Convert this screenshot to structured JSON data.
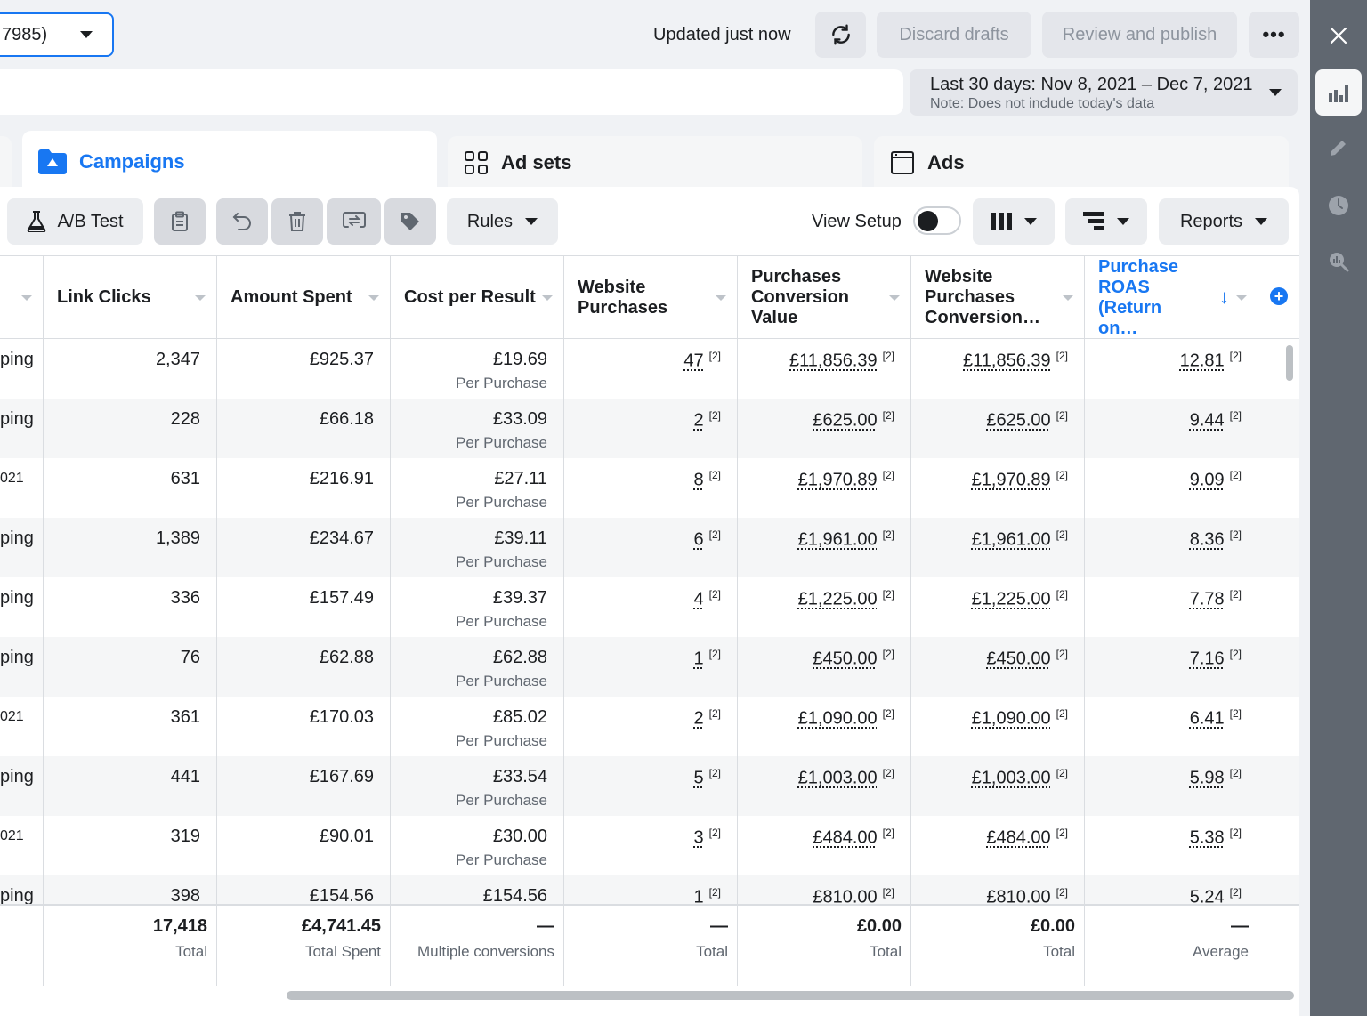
{
  "topbar": {
    "account_value": "7985)",
    "updated_text": "Updated just now",
    "discard_label": "Discard drafts",
    "publish_label": "Review and publish",
    "more_label": "•••"
  },
  "date": {
    "range": "Last 30 days: Nov 8, 2021 – Dec 7, 2021",
    "note": "Note: Does not include today's data"
  },
  "tabs": [
    {
      "label": "Campaigns"
    },
    {
      "label": "Ad sets"
    },
    {
      "label": "Ads"
    }
  ],
  "toolbar": {
    "ab_label": "A/B Test",
    "rules_label": "Rules",
    "view_setup_label": "View Setup",
    "reports_label": "Reports"
  },
  "columns": [
    {
      "label": ""
    },
    {
      "label": "Link Clicks"
    },
    {
      "label": "Amount Spent"
    },
    {
      "label": "Cost per Result"
    },
    {
      "label": "Website Purchases"
    },
    {
      "label": "Purchases Conversion Value"
    },
    {
      "label": "Website Purchases Conversion…"
    },
    {
      "label": "Purchase ROAS (Return on…"
    }
  ],
  "rows": [
    {
      "name": "ping",
      "clicks": "2,347",
      "spent": "£925.37",
      "cpr": "£19.69",
      "cpr_sub": "Per Purchase",
      "purchases": "47",
      "conv_value": "£11,856.39",
      "web_conv": "£11,856.39",
      "roas": "12.81",
      "ref": "[2]"
    },
    {
      "name": "ping",
      "clicks": "228",
      "spent": "£66.18",
      "cpr": "£33.09",
      "cpr_sub": "Per Purchase",
      "purchases": "2",
      "conv_value": "£625.00",
      "web_conv": "£625.00",
      "roas": "9.44",
      "ref": "[2]"
    },
    {
      "name": "021",
      "clicks": "631",
      "spent": "£216.91",
      "cpr": "£27.11",
      "cpr_sub": "Per Purchase",
      "purchases": "8",
      "conv_value": "£1,970.89",
      "web_conv": "£1,970.89",
      "roas": "9.09",
      "ref": "[2]"
    },
    {
      "name": "ping",
      "clicks": "1,389",
      "spent": "£234.67",
      "cpr": "£39.11",
      "cpr_sub": "Per Purchase",
      "purchases": "6",
      "conv_value": "£1,961.00",
      "web_conv": "£1,961.00",
      "roas": "8.36",
      "ref": "[2]"
    },
    {
      "name": "ping",
      "clicks": "336",
      "spent": "£157.49",
      "cpr": "£39.37",
      "cpr_sub": "Per Purchase",
      "purchases": "4",
      "conv_value": "£1,225.00",
      "web_conv": "£1,225.00",
      "roas": "7.78",
      "ref": "[2]"
    },
    {
      "name": "ping",
      "clicks": "76",
      "spent": "£62.88",
      "cpr": "£62.88",
      "cpr_sub": "Per Purchase",
      "purchases": "1",
      "conv_value": "£450.00",
      "web_conv": "£450.00",
      "roas": "7.16",
      "ref": "[2]"
    },
    {
      "name": "021",
      "clicks": "361",
      "spent": "£170.03",
      "cpr": "£85.02",
      "cpr_sub": "Per Purchase",
      "purchases": "2",
      "conv_value": "£1,090.00",
      "web_conv": "£1,090.00",
      "roas": "6.41",
      "ref": "[2]"
    },
    {
      "name": "ping",
      "clicks": "441",
      "spent": "£167.69",
      "cpr": "£33.54",
      "cpr_sub": "Per Purchase",
      "purchases": "5",
      "conv_value": "£1,003.00",
      "web_conv": "£1,003.00",
      "roas": "5.98",
      "ref": "[2]"
    },
    {
      "name": "021",
      "clicks": "319",
      "spent": "£90.01",
      "cpr": "£30.00",
      "cpr_sub": "Per Purchase",
      "purchases": "3",
      "conv_value": "£484.00",
      "web_conv": "£484.00",
      "roas": "5.38",
      "ref": "[2]"
    },
    {
      "name": "ping",
      "clicks": "398",
      "spent": "£154.56",
      "cpr": "£154.56",
      "cpr_sub": "",
      "purchases": "1",
      "conv_value": "£810.00",
      "web_conv": "£810.00",
      "roas": "5.24",
      "ref": "[2]"
    }
  ],
  "totals": {
    "clicks": {
      "value": "17,418",
      "label": "Total"
    },
    "spent": {
      "value": "£4,741.45",
      "label": "Total Spent"
    },
    "cpr": {
      "value": "—",
      "label": "Multiple conversions"
    },
    "purchases": {
      "value": "—",
      "label": "Total"
    },
    "conv_value": {
      "value": "£0.00",
      "label": "Total"
    },
    "web_conv": {
      "value": "£0.00",
      "label": "Total"
    },
    "roas": {
      "value": "—",
      "label": "Average"
    }
  },
  "colors": {
    "accent": "#1877f2",
    "rail": "#606770"
  }
}
